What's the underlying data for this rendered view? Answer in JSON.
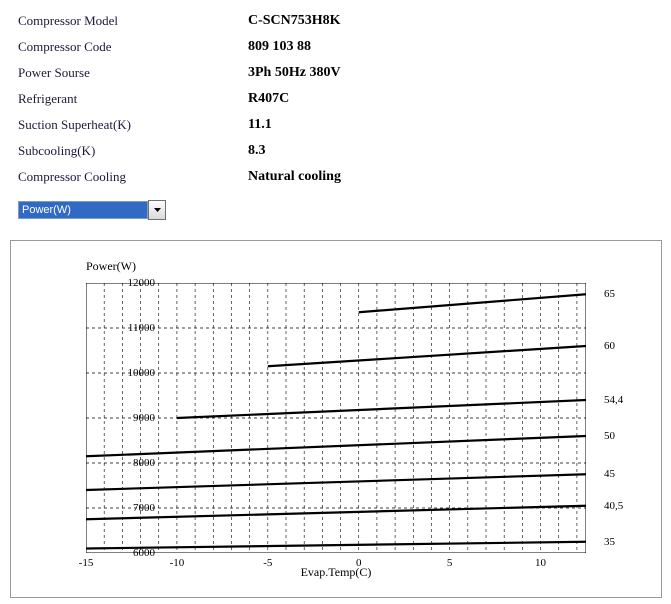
{
  "spec": {
    "rows": [
      {
        "label": "Compressor Model",
        "value": "C-SCN753H8K"
      },
      {
        "label": "Compressor Code",
        "value": "809 103 88"
      },
      {
        "label": "Power Sourse",
        "value": "3Ph  50Hz  380V"
      },
      {
        "label": "Refrigerant",
        "value": "R407C"
      },
      {
        "label": "Suction Superheat(K)",
        "value": "11.1"
      },
      {
        "label": "Subcooling(K)",
        "value": "8.3"
      },
      {
        "label": "Compressor Cooling",
        "value": "Natural cooling"
      }
    ]
  },
  "dropdown": {
    "selected": "Power(W)"
  },
  "chart_data": {
    "type": "line",
    "title": "Power(W)",
    "xlabel": "Evap.Temp(C)",
    "ylabel": "Power(W)",
    "xlim": [
      -15,
      12.5
    ],
    "ylim": [
      6000,
      12000
    ],
    "xticks": [
      -15,
      -10,
      -5,
      0,
      5,
      10
    ],
    "yticks": [
      6000,
      7000,
      8000,
      9000,
      10000,
      11000,
      12000
    ],
    "xgrid_minor": 1,
    "series": [
      {
        "name": "65",
        "x": [
          0,
          12.5
        ],
        "y": [
          11350,
          11750
        ]
      },
      {
        "name": "60",
        "x": [
          -5,
          12.5
        ],
        "y": [
          10150,
          10600
        ]
      },
      {
        "name": "54,4",
        "x": [
          -10,
          12.5
        ],
        "y": [
          9000,
          9400
        ]
      },
      {
        "name": "50",
        "x": [
          -15,
          12.5
        ],
        "y": [
          8150,
          8600
        ]
      },
      {
        "name": "45",
        "x": [
          -15,
          12.5
        ],
        "y": [
          7400,
          7750
        ]
      },
      {
        "name": "40,5",
        "x": [
          -15,
          12.5
        ],
        "y": [
          6750,
          7050
        ]
      },
      {
        "name": "35",
        "x": [
          -15,
          12.5
        ],
        "y": [
          6100,
          6250
        ]
      }
    ]
  }
}
